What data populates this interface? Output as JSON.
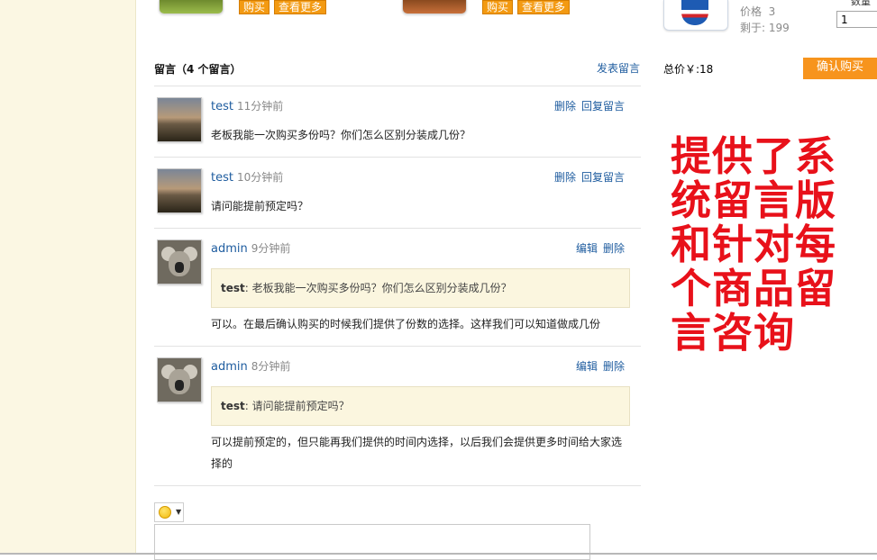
{
  "products": {
    "buy_label": "购买",
    "more_label": "查看更多"
  },
  "cart": {
    "price_label": "价格",
    "price_value": "3",
    "remaining_label": "剩于:",
    "remaining_value": "199",
    "qty_header": "数量",
    "qty_value": "1",
    "total_text": "总价￥:18",
    "confirm_label": "确认购买"
  },
  "comments": {
    "title": "留言（4 个留言）",
    "post_link": "发表留言",
    "delete_label": "删除",
    "reply_label": "回复留言",
    "edit_label": "编辑",
    "items": [
      {
        "author": "test",
        "time": "11分钟前",
        "text": "老板我能一次购买多份吗？你们怎么区别分装成几份？"
      },
      {
        "author": "test",
        "time": "10分钟前",
        "text": "请问能提前预定吗？"
      },
      {
        "author": "admin",
        "time": "9分钟前",
        "quote_author": "test",
        "quote_text": ": 老板我能一次购买多份吗？你们怎么区别分装成几份？",
        "text": "可以。在最后确认购买的时候我们提供了份数的选择。这样我们可以知道做成几份"
      },
      {
        "author": "admin",
        "time": "8分钟前",
        "quote_author": "test",
        "quote_text": ": 请问能提前预定吗？",
        "text": "可以提前预定的，但只能再我们提供的时间内选择，以后我们会提供更多时间给大家选择的"
      }
    ]
  },
  "overlay_text": "提供了系统留言版和针对每个商品留言咨询",
  "icons": {
    "emoji": "smile-icon"
  }
}
